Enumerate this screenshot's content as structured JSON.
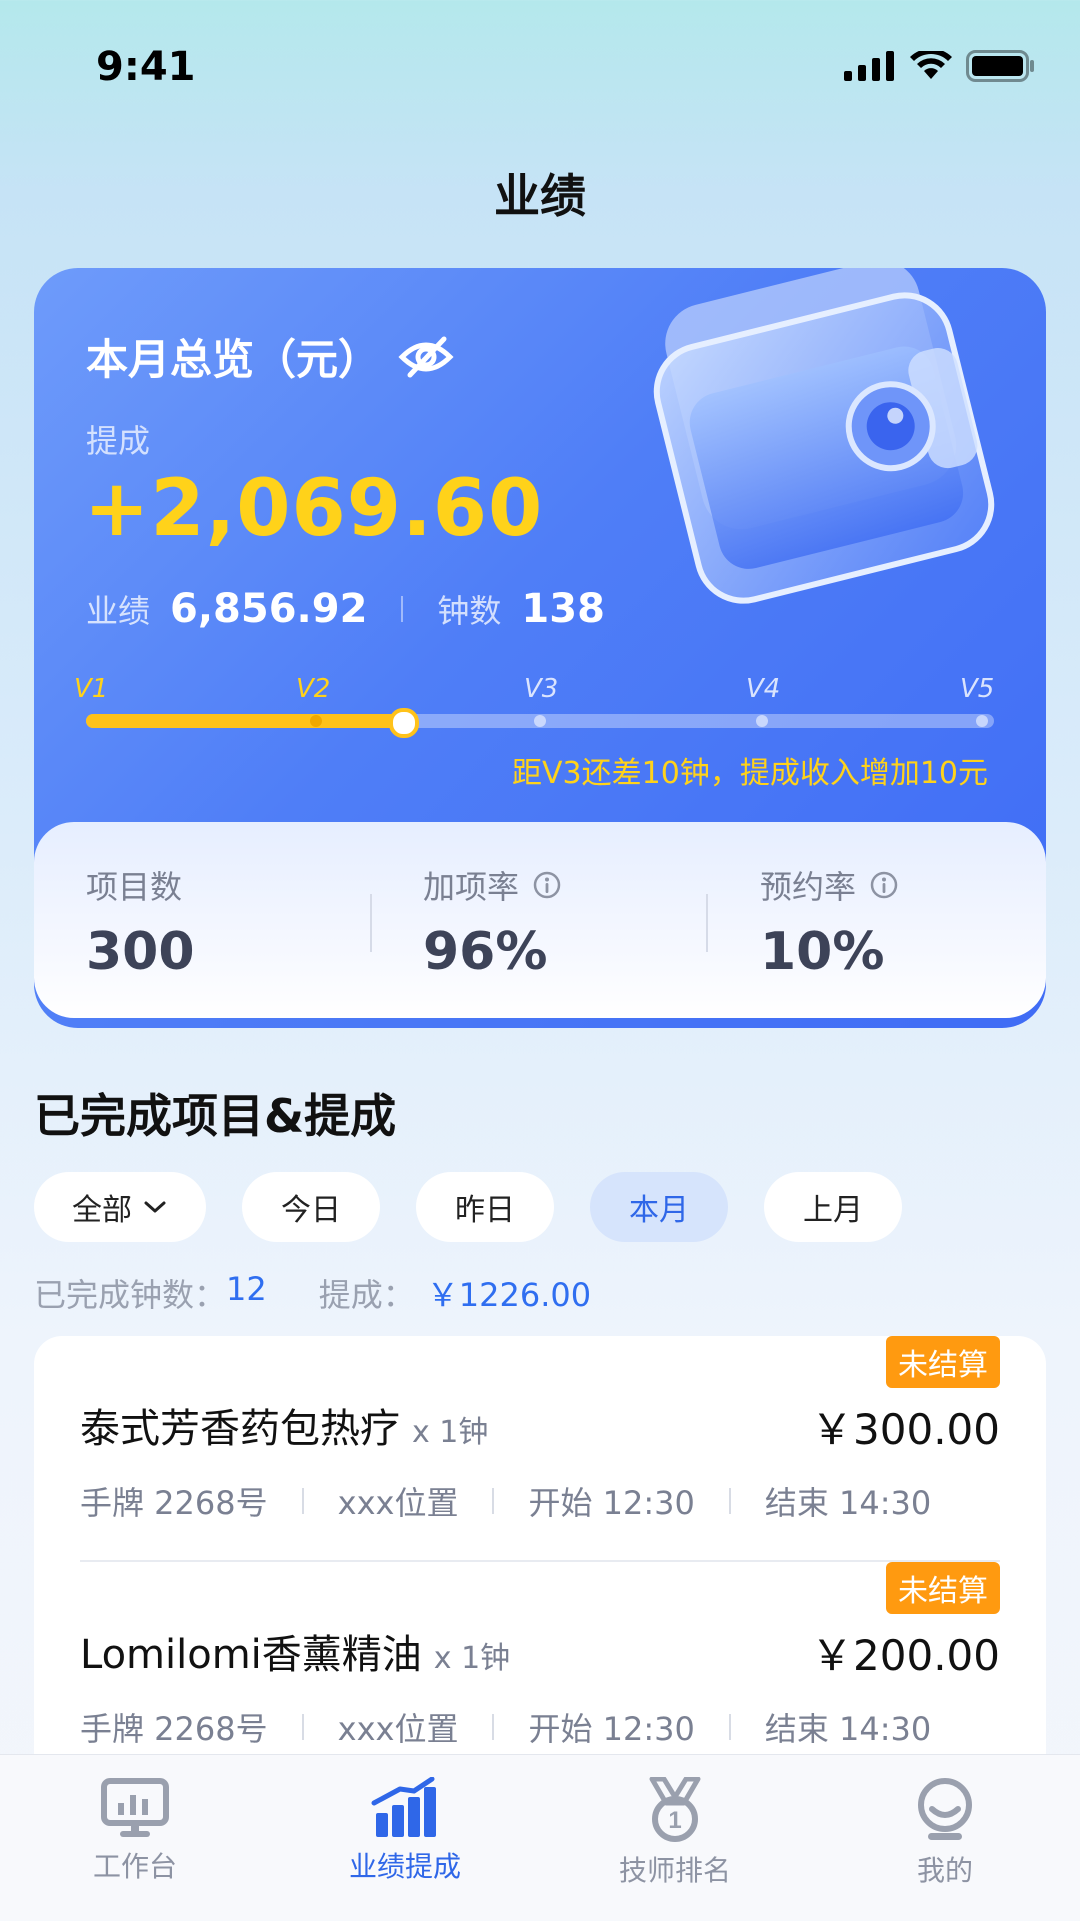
{
  "status_bar": {
    "time": "9:41"
  },
  "header": {
    "title": "业绩"
  },
  "overview": {
    "title": "本月总览（元）",
    "commission_label": "提成",
    "commission_value": "+2,069.60",
    "performance_label": "业绩",
    "performance_value": "6,856.92",
    "hours_label": "钟数",
    "hours_value": "138",
    "levels": [
      "V1",
      "V2",
      "V3",
      "V4",
      "V5"
    ],
    "progress_fraction": 0.35,
    "hint": "距V3还差10钟，提成收入增加10元"
  },
  "stats": [
    {
      "label": "项目数",
      "value": "300"
    },
    {
      "label": "加项率",
      "value": "96%"
    },
    {
      "label": "预约率",
      "value": "10%"
    }
  ],
  "section": {
    "title": "已完成项目&提成",
    "filters": [
      "全部",
      "今日",
      "昨日",
      "本月",
      "上月"
    ],
    "active_filter": "本月",
    "summary": {
      "hours_label": "已完成钟数：",
      "hours_value": "12",
      "commission_label": "提成：",
      "commission_value": "￥1226.00"
    }
  },
  "items": [
    {
      "badge": "未结算",
      "name": "泰式芳香药包热疗",
      "qty": "x 1钟",
      "price": "￥300.00",
      "tag": "手牌 2268号",
      "location": "xxx位置",
      "start": "开始 12:30",
      "end": "结束 14:30"
    },
    {
      "badge": "未结算",
      "name": "Lomilomi香薰精油",
      "qty": "x 1钟",
      "price": "￥200.00",
      "tag": "手牌 2268号",
      "location": "xxx位置",
      "start": "开始 12:30",
      "end": "结束 14:30"
    }
  ],
  "tabbar": [
    {
      "label": "工作台",
      "icon": "monitor-icon"
    },
    {
      "label": "业绩提成",
      "icon": "bar-chart-icon"
    },
    {
      "label": "技师排名",
      "icon": "medal-icon"
    },
    {
      "label": "我的",
      "icon": "user-icon"
    }
  ],
  "colors": {
    "accent": "#2f67e8",
    "card_blue": "#4f7ef7",
    "gold": "#ffd21a",
    "badge_orange": "#ff9a10"
  }
}
